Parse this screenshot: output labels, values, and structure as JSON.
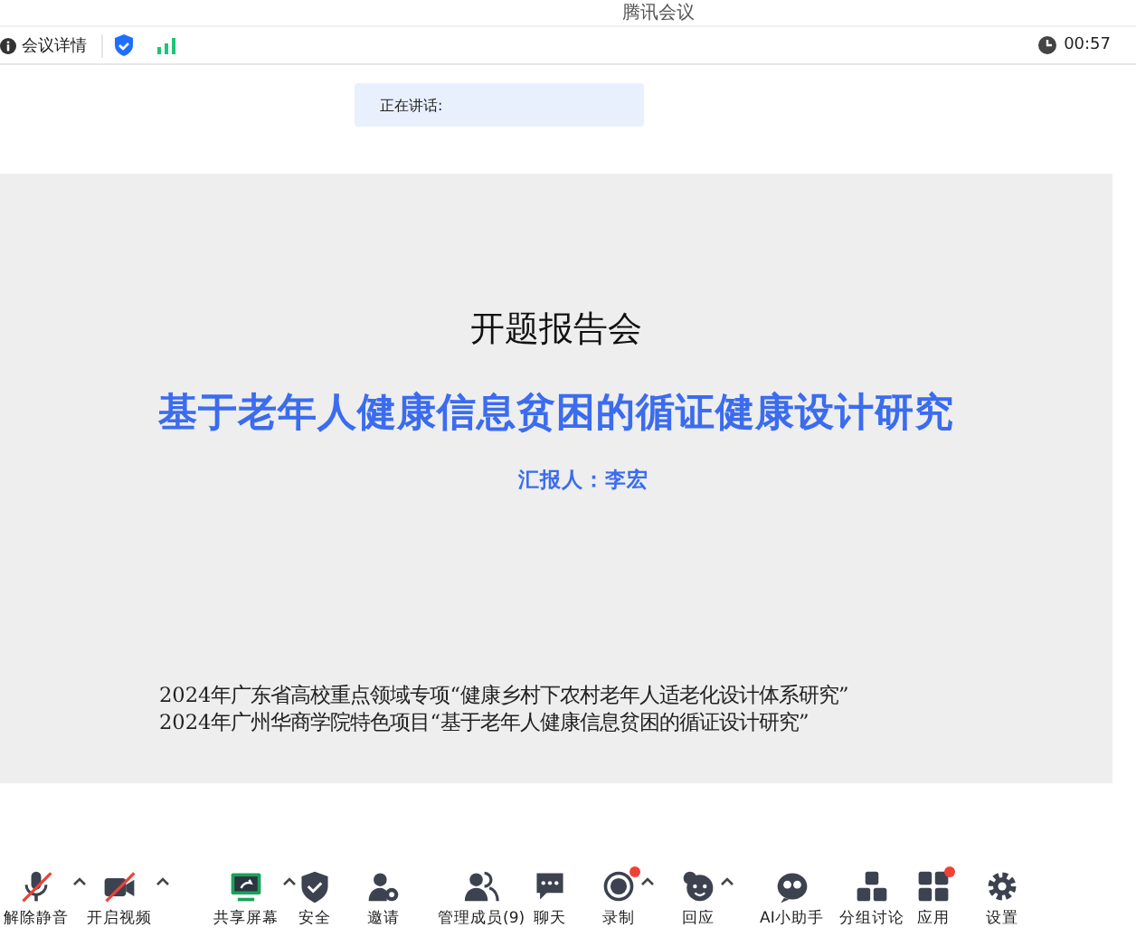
{
  "window": {
    "title": "腾讯会议"
  },
  "info_bar": {
    "details_label": "会议详情",
    "timer": "00:57"
  },
  "speaking": {
    "label": "正在讲话:"
  },
  "slide": {
    "heading": "开题报告会",
    "title": "基于老年人健康信息贫困的循证健康设计研究",
    "presenter": "汇报人：李宏",
    "notes": [
      "2024年广东省高校重点领域专项“健康乡村下农村老年人适老化设计体系研究”",
      "2024年广州华商学院特色项目“基于老年人健康信息贫困的循证设计研究”"
    ]
  },
  "toolbar": [
    {
      "kind": "mic",
      "label": "解除静音",
      "off": true,
      "caret": true,
      "badge": false
    },
    {
      "kind": "video",
      "label": "开启视频",
      "off": true,
      "caret": true,
      "badge": false
    },
    {
      "kind": "share",
      "label": "共享屏幕",
      "off": false,
      "caret": true,
      "badge": false
    },
    {
      "kind": "shield",
      "label": "安全",
      "off": false,
      "caret": false,
      "badge": false
    },
    {
      "kind": "invite",
      "label": "邀请",
      "off": false,
      "caret": false,
      "badge": false
    },
    {
      "kind": "members",
      "label": "管理成员(9)",
      "off": false,
      "caret": false,
      "badge": false
    },
    {
      "kind": "chat",
      "label": "聊天",
      "off": false,
      "caret": false,
      "badge": false
    },
    {
      "kind": "record",
      "label": "录制",
      "off": false,
      "caret": true,
      "badge": true
    },
    {
      "kind": "reaction",
      "label": "回应",
      "off": false,
      "caret": true,
      "badge": false
    },
    {
      "kind": "assistant",
      "label": "AI小助手",
      "off": false,
      "caret": false,
      "badge": false
    },
    {
      "kind": "breakout",
      "label": "分组讨论",
      "off": false,
      "caret": false,
      "badge": false
    },
    {
      "kind": "apps",
      "label": "应用",
      "off": false,
      "caret": false,
      "badge": true
    },
    {
      "kind": "settings",
      "label": "设置",
      "off": false,
      "caret": false,
      "badge": false
    }
  ]
}
